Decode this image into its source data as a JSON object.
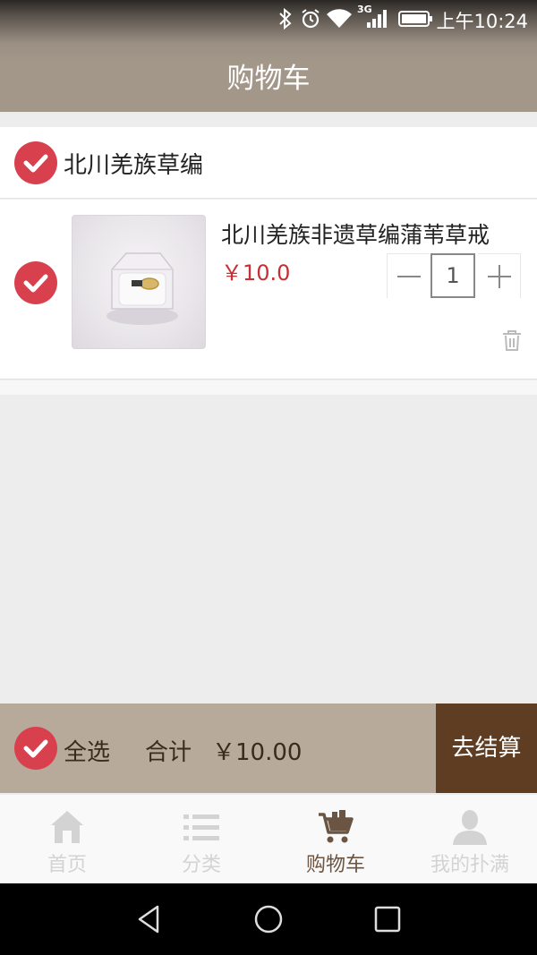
{
  "status_bar": {
    "time": "上午10:24",
    "network": "3G",
    "icons": [
      "bluetooth-icon",
      "alarm-icon",
      "wifi-icon",
      "signal-icon",
      "battery-icon"
    ]
  },
  "header": {
    "title": "购物车"
  },
  "shop": {
    "name": "北川羌族草编",
    "checked": true
  },
  "cart_items": [
    {
      "name": "北川羌族非遗草编蒲苇草戒",
      "price": "￥10.0",
      "quantity": "1",
      "checked": true
    }
  ],
  "checkout_bar": {
    "select_all_label": "全选",
    "total_label": "合计",
    "total_value": "￥10.00",
    "checkout_button": "去结算"
  },
  "tabs": [
    {
      "label": "首页",
      "icon": "home-icon",
      "active": false
    },
    {
      "label": "分类",
      "icon": "list-icon",
      "active": false
    },
    {
      "label": "购物车",
      "icon": "cart-icon",
      "active": true
    },
    {
      "label": "我的扑满",
      "icon": "user-icon",
      "active": false
    }
  ],
  "colors": {
    "header": "#a39789",
    "check": "#d9404e",
    "price": "#c62f33",
    "checkout_bar": "#b8aa9a",
    "checkout_button": "#5e3d22",
    "tab_active": "#6b5542",
    "tab_inactive": "#d3d3d3"
  }
}
